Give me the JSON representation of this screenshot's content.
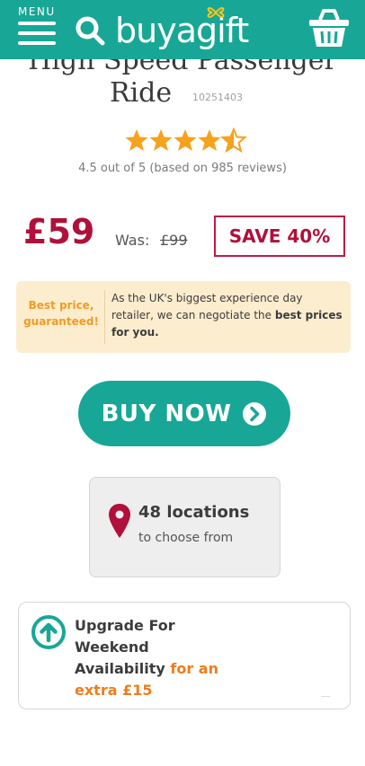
{
  "header": {
    "menu_label": "MENU",
    "logo_text": "buyagift",
    "background": "#18a796",
    "icons": [
      "hamburger-icon",
      "search-icon",
      "basket-icon",
      "bow-icon"
    ]
  },
  "product": {
    "title_partial": "High Speed Passenger",
    "title_line2": "Ride",
    "code": "10251403",
    "rating_value": 4.5,
    "rating_max": 5,
    "rating_text": "4.5 out of 5 (based on 985 reviews)"
  },
  "pricing": {
    "price": "£59",
    "was_label": "Was:",
    "was_value": "£99",
    "save_label": "SAVE 40%",
    "price_color": "#b0103a"
  },
  "promo": {
    "badge_line1": "Best price,",
    "badge_line2": "guaranteed!",
    "text_plain": "As the UK's biggest experience day retailer, we can negotiate the ",
    "text_bold": "best prices for you."
  },
  "buy": {
    "label": "BUY NOW",
    "icon": "chevron-circle-icon"
  },
  "locations": {
    "count_label": "48 locations",
    "sub_label": "to choose from",
    "icon": "map-pin-icon"
  },
  "upgrade": {
    "line1": "Upgrade For",
    "line2": "Weekend",
    "line3_plain": "Availability ",
    "line3_accent": "for an",
    "line4_accent": "extra £15",
    "icon": "arrow-up-circle-icon",
    "accent_color": "#f07c1b"
  }
}
